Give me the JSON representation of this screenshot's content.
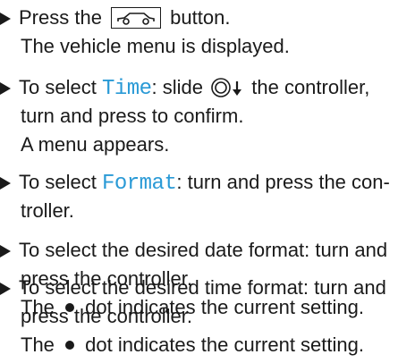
{
  "steps": [
    {
      "line1_pre": "Press the",
      "button_icon": "vehicle-button-icon",
      "line1_post": " button.",
      "result": "The vehicle menu is displayed."
    },
    {
      "line1_pre": "To select ",
      "keyword": "Time",
      "line1_mid": ": slide ",
      "controller_icon": "controller-slide-down-icon",
      "line1_post": " the controller,",
      "line2": "turn and press to confirm.",
      "result": "A menu appears."
    },
    {
      "line1_pre": "To select ",
      "keyword": "Format",
      "line1_post": ": turn and press the con-",
      "line2": "troller."
    },
    {
      "line1": "To select the desired date format: turn and",
      "line2": "press the controller.",
      "result_pre": "The ",
      "dot_icon": "dot-icon",
      "result_post": " dot indicates the current setting."
    },
    {
      "line1": "To select the desired time format: turn and",
      "line2": "press the controller.",
      "result_pre": "The ",
      "dot_icon": "dot-icon",
      "result_post": " dot indicates the current setting."
    }
  ],
  "colors": {
    "keyword": "#2a9ad6",
    "text": "#1a1a1a"
  },
  "bullet_icon": "triangle-bullet-icon"
}
